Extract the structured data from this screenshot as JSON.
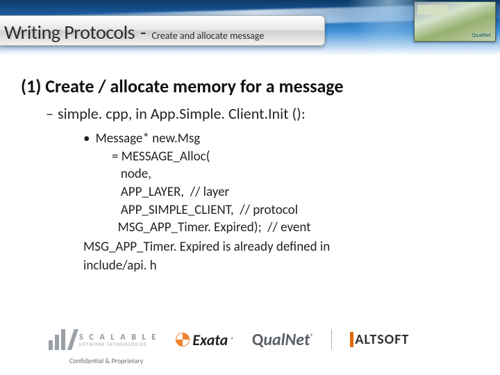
{
  "header": {
    "title_main": "Writing Protocols",
    "title_dash": "-",
    "title_sub": "Create and allocate message",
    "corner_label": "QualNet"
  },
  "content": {
    "heading": "(1) Create / allocate memory for a message",
    "sub_dash": "–",
    "sub_text": "simple. cpp, in App.Simple. Client.Init ():",
    "bullet_dot": "•",
    "code_line1": "Message* new.Msg",
    "code_lines": [
      "   = MESSAGE_Alloc(",
      "      node,",
      "      APP_LAYER,  // layer",
      "      APP_SIMPLE_CLIENT,  // protocol",
      "     MSG_APP_Timer. Expired);  // event"
    ],
    "tail1": "MSG_APP_Timer. Expired is already defined in",
    "tail2": "include/api. h"
  },
  "logos": {
    "scalable_line1": "S C A L A B L E",
    "scalable_line2": "NETWORK TECHNOLOGIES",
    "exata": "Exata",
    "qualnet_q": "Q",
    "qualnet_rest": "ualNet",
    "altsoft": "ALTSOFT",
    "reg": "®"
  },
  "footer": {
    "confidential": "Confidential & Proprietary"
  }
}
